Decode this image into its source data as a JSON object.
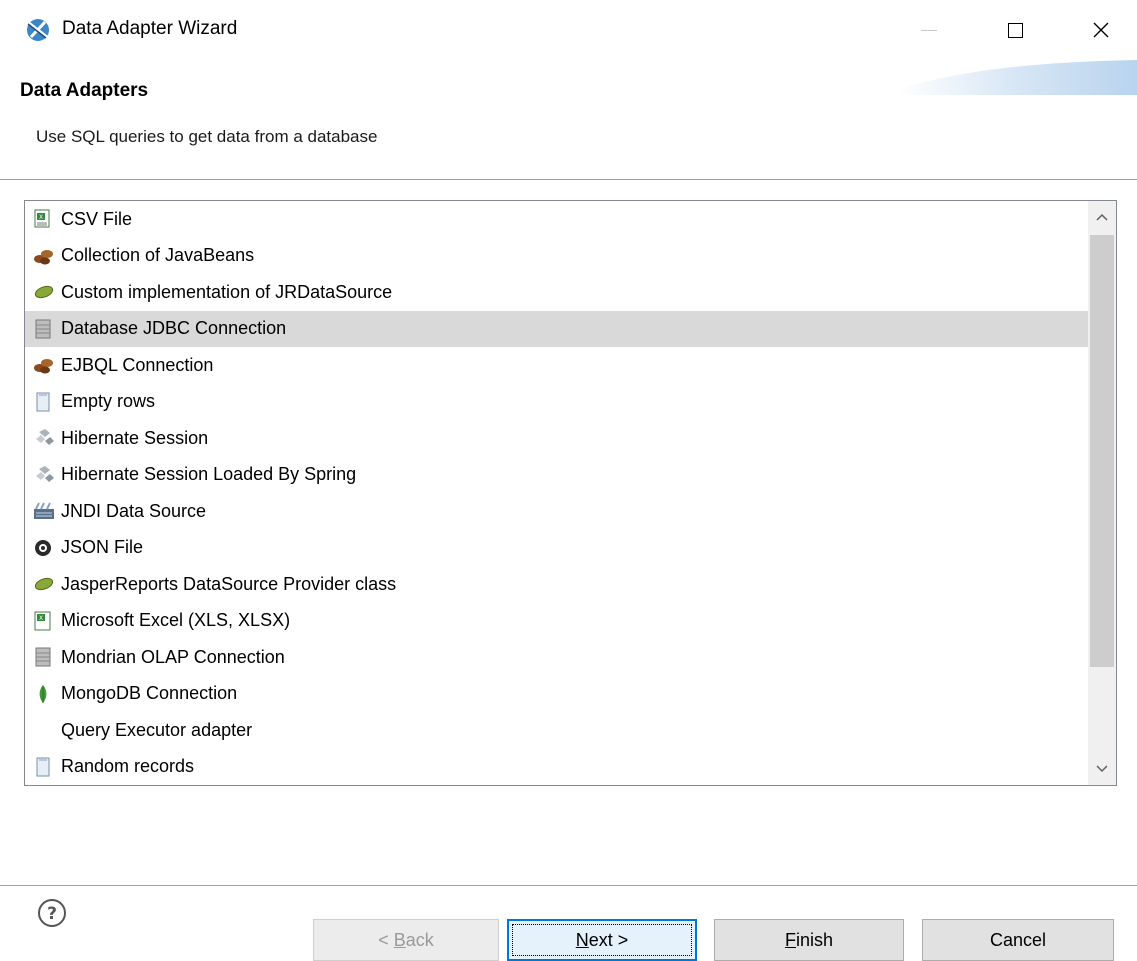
{
  "window": {
    "title": "Data Adapter Wizard",
    "icon": "jaspersoft-wizard-icon",
    "controls": [
      "minimize-icon",
      "maximize-icon",
      "close-icon"
    ]
  },
  "header": {
    "title": "Data Adapters",
    "description": "Use SQL queries to get data from a database"
  },
  "adapters": {
    "selected_index": 3,
    "items": [
      {
        "label": "CSV File",
        "icon": "csv-file-icon"
      },
      {
        "label": "Collection of JavaBeans",
        "icon": "javabeans-icon"
      },
      {
        "label": "Custom implementation of JRDataSource",
        "icon": "custom-datasource-icon"
      },
      {
        "label": "Database JDBC Connection",
        "icon": "database-jdbc-icon"
      },
      {
        "label": "EJBQL Connection",
        "icon": "ejbql-icon"
      },
      {
        "label": "Empty rows",
        "icon": "empty-rows-icon"
      },
      {
        "label": "Hibernate Session",
        "icon": "hibernate-icon"
      },
      {
        "label": "Hibernate Session Loaded By Spring",
        "icon": "hibernate-spring-icon"
      },
      {
        "label": "JNDI Data Source",
        "icon": "jndi-icon"
      },
      {
        "label": "JSON File",
        "icon": "json-file-icon"
      },
      {
        "label": "JasperReports DataSource Provider class",
        "icon": "datasource-provider-icon"
      },
      {
        "label": "Microsoft Excel (XLS, XLSX)",
        "icon": "excel-icon"
      },
      {
        "label": "Mondrian OLAP Connection",
        "icon": "mondrian-olap-icon"
      },
      {
        "label": "MongoDB Connection",
        "icon": "mongodb-icon"
      },
      {
        "label": "Query Executor adapter",
        "icon": ""
      },
      {
        "label": "Random records",
        "icon": "random-records-icon"
      }
    ]
  },
  "buttons": {
    "back_prefix": "< ",
    "back_mnemonic": "B",
    "back_rest": "ack",
    "next_mnemonic": "N",
    "next_rest": "ext >",
    "finish_mnemonic": "F",
    "finish_rest": "inish",
    "cancel": "Cancel"
  },
  "colors": {
    "selection": "#d9d9d9",
    "default_button_border": "#0078d7",
    "separator": "#a0a0a0"
  }
}
